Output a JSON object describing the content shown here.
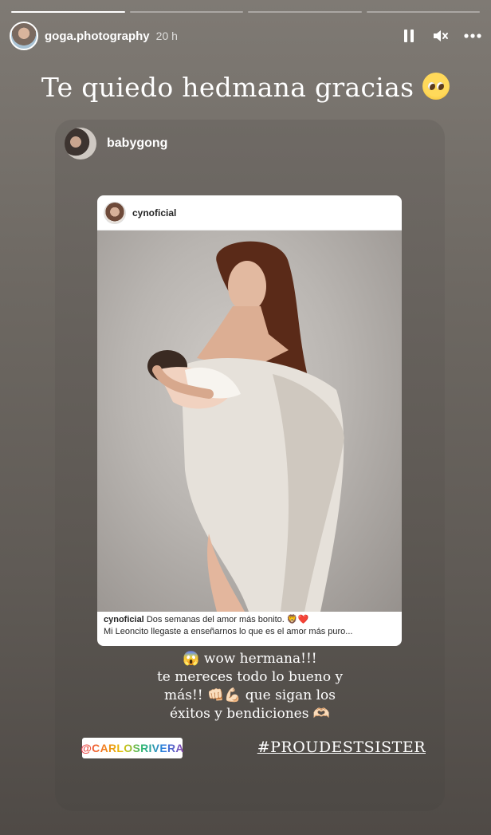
{
  "story": {
    "segments": [
      1,
      0,
      0,
      0
    ],
    "username": "goga.photography",
    "time": "20 h",
    "caption": "Te quiedo hedmana gracias",
    "caption_emoji": "pleading-face"
  },
  "shared_card": {
    "username": "babygong",
    "post": {
      "username": "cynoficial",
      "caption_user": "cynoficial",
      "caption_line1": "Dos semanas del amor más bonito.",
      "caption_emojis": "🦁❤️",
      "caption_line2": "Mi Leoncito llegaste a enseñarnos lo que es el amor más puro..."
    },
    "reply_lines": [
      "😱 wow hermana!!!",
      "te mereces todo lo bueno y",
      "más!! 👊🏻💪🏻 que sigan los",
      "éxitos y bendiciones 🫶🏻"
    ],
    "mention": "@CARLOSRIVERA",
    "hashtag": "#PROUDESTSISTER"
  },
  "icons": {
    "pause": "pause-icon",
    "mute": "mute-icon",
    "more": "more-icon"
  },
  "colors": {
    "background": "#6d6862",
    "card": "#5d5853",
    "heart": "#e0245e"
  }
}
